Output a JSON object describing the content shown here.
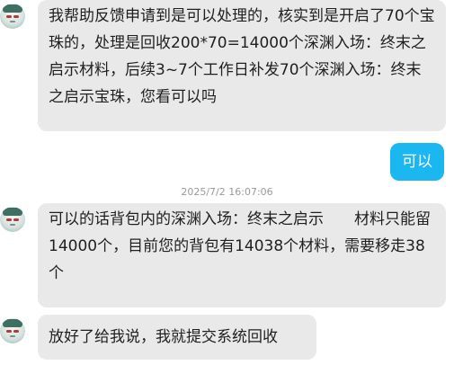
{
  "messages": [
    {
      "sender": "agent",
      "text": "我帮助反馈申请到是可以处理的，核实到是开启了70个宝珠的，处理是回收200*70=14000个深渊入场：终末之启示材料，后续3~7个工作日补发70个深渊入场：终末之启示宝珠，您看可以吗"
    },
    {
      "sender": "user",
      "text": "可以"
    },
    {
      "sender": "agent",
      "text": "可以的话背包内的深渊入场：终末之启示　　材料只能留14000个，目前您的背包有14038个材料，需要移走38个"
    },
    {
      "sender": "agent",
      "text": "放好了给我说，我就提交系统回收"
    }
  ],
  "timestamp": "2025/7/2 16:07:06",
  "colors": {
    "incoming_bubble": "#e9e9e9",
    "outgoing_bubble": "#1bb7f0",
    "timestamp_text": "#9a9a9a"
  },
  "icons": {
    "agent_avatar": "anime-avatar-icon"
  }
}
